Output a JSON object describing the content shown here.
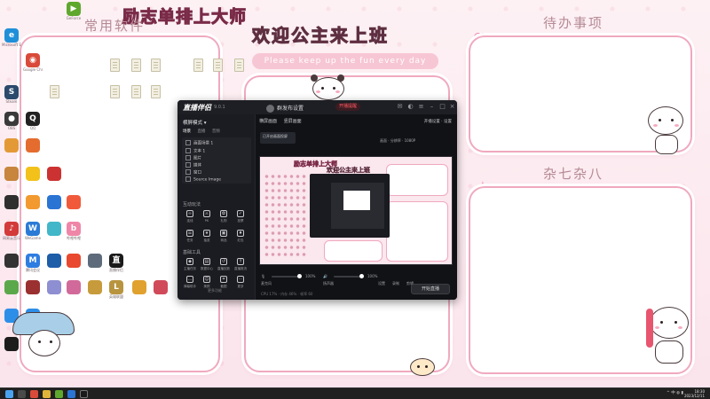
{
  "wallpaper": {
    "banner_title": "励志单排上大师",
    "banner_subtitle": "欢迎公主来上班",
    "banner_tagline": "Please keep up the fun every day",
    "panel_common_software": "常用软件",
    "panel_todo": "待办事项",
    "panel_misc": "杂七杂八",
    "colors": {
      "accent": "#f0a9bf",
      "banner_pink": "#ff5f93"
    }
  },
  "desktop_icons": [
    {
      "label": "Microsoft Edge",
      "glyph": "e",
      "color": "#1f8fd8"
    },
    {
      "label": "Google Chrome",
      "glyph": "◉",
      "color": "#d94a3a"
    },
    {
      "label": "GeForce",
      "glyph": "▶",
      "color": "#5ea82d"
    },
    {
      "label": "Steam",
      "glyph": "S",
      "color": "#2b4a6c"
    },
    {
      "label": "OBS",
      "glyph": "●",
      "color": "#3a3a3a"
    },
    {
      "label": "QQ",
      "glyph": "Q",
      "color": "#222222"
    },
    {
      "label": "网易云音乐",
      "glyph": "♪",
      "color": "#d33a3a"
    },
    {
      "label": "WeGame",
      "glyph": "W",
      "color": "#2b7bd6"
    },
    {
      "label": "腾讯会议",
      "glyph": "M",
      "color": "#2e7de1"
    },
    {
      "label": "哔哩哔哩",
      "glyph": "b",
      "color": "#ef86a8"
    },
    {
      "label": "英雄联盟",
      "glyph": "L",
      "color": "#b8943f"
    },
    {
      "label": "直播伴侣",
      "glyph": "直",
      "color": "#1a1a1a"
    }
  ],
  "app": {
    "title": "直播伴侣",
    "version": "9.0.1",
    "user_name": "群发布设置",
    "live_badge": "开播提醒",
    "mode_label": "横屏模式 ▾",
    "subtabs": [
      "场景",
      "直播",
      "音频"
    ],
    "scene_header": "画面场景 1",
    "scenes": [
      "文本 1",
      "图片",
      "媒体",
      "窗口",
      "Source Image"
    ],
    "section_interact": "互动玩法",
    "interact_tools": [
      "连线",
      "PK",
      "礼物",
      "投票",
      "任务",
      "抽奖",
      "商品",
      "红包"
    ],
    "section_basic": "基础工具",
    "basic_tools": [
      "主播任务",
      "数据中心",
      "直播回放",
      "直播推流",
      "弹幕助手",
      "美颜",
      "截图",
      "更多"
    ],
    "more_functions": "更多功能",
    "main_tabs": [
      "横屏画面",
      "竖屏画面"
    ],
    "main_top_right": "开播设置 · 设置",
    "thumb_label": "已开启画面投屏",
    "ctrl_row": "画面 · 分辨率 · 1080P",
    "preview_title": "励志单排上大师",
    "preview_sub": "欢迎公主来上班",
    "mixer": {
      "mic_label": "麦克风",
      "mic_value": "100%",
      "speaker_label": "扬声器",
      "speaker_value": "100%",
      "tools": [
        "设置",
        "录制",
        "剪辑"
      ]
    },
    "go_live": "开始直播",
    "status": "CPU 17% · 内存 46% · 帧率 60"
  },
  "taskbar": {
    "tray": "^ 中 ◍ ▮",
    "time": "18:30",
    "date": "2023/12/11"
  }
}
